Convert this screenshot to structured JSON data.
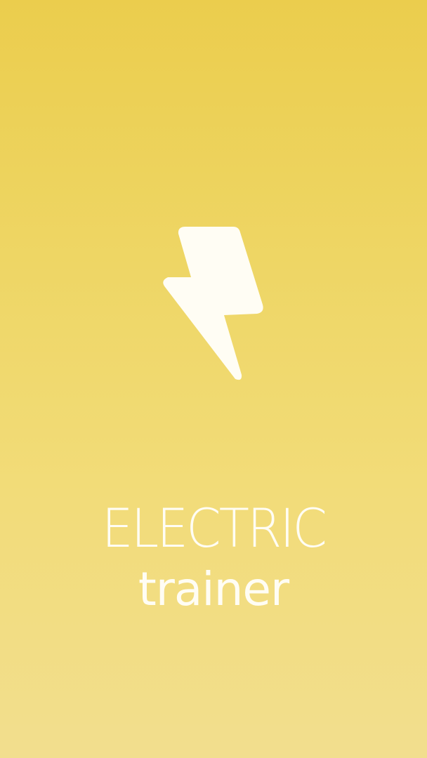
{
  "screen": {
    "icon": "lightning-bolt-icon",
    "title": "ELECTRIC",
    "subtitle": "trainer"
  },
  "colors": {
    "background_top": "#EBCD4D",
    "background_bottom": "#F2DE8E",
    "foreground": "#FFFDF4"
  }
}
